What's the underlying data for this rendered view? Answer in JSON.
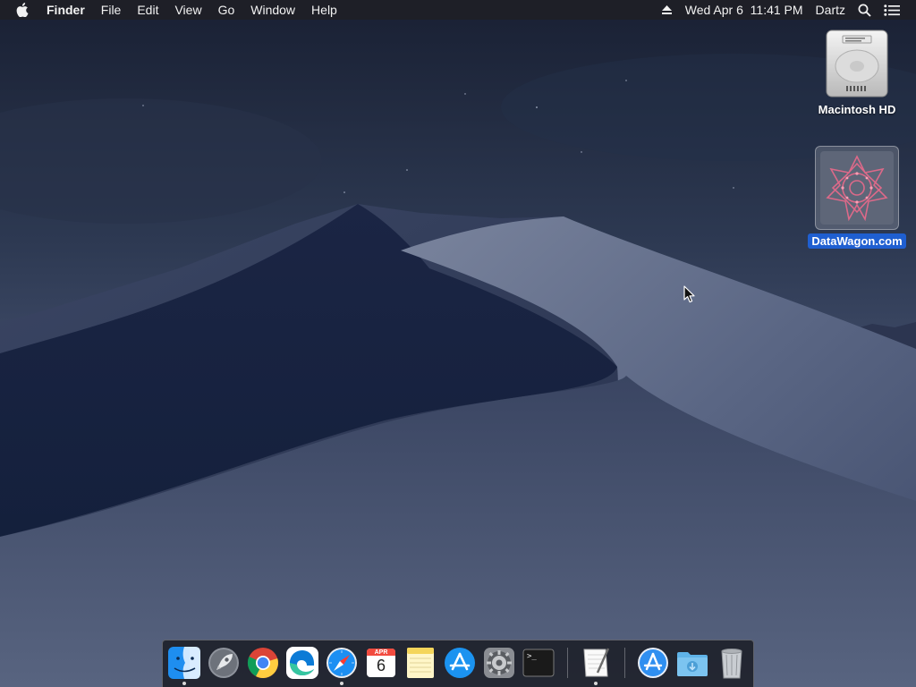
{
  "menubar": {
    "app_name": "Finder",
    "menus": [
      "File",
      "Edit",
      "View",
      "Go",
      "Window",
      "Help"
    ],
    "datetime": "Wed Apr 6  11:41 PM",
    "user": "Dartz"
  },
  "desktop": {
    "icons": [
      {
        "label": "Macintosh HD",
        "icon": "hard-drive-icon",
        "selected": false
      },
      {
        "label": "DataWagon.com",
        "icon": "disk-image-icon",
        "selected": true
      }
    ]
  },
  "dock": {
    "items": [
      {
        "name": "Finder",
        "icon": "finder-icon",
        "running": true
      },
      {
        "name": "Launchpad",
        "icon": "launchpad-icon",
        "running": false
      },
      {
        "name": "Google Chrome",
        "icon": "chrome-icon",
        "running": false
      },
      {
        "name": "Microsoft Edge",
        "icon": "edge-icon",
        "running": false
      },
      {
        "name": "Safari",
        "icon": "safari-icon",
        "running": true
      },
      {
        "name": "Calendar",
        "icon": "calendar-icon",
        "running": false,
        "month": "APR",
        "day": "6"
      },
      {
        "name": "Notes",
        "icon": "notes-icon",
        "running": false
      },
      {
        "name": "App Store",
        "icon": "app-store-icon",
        "running": false
      },
      {
        "name": "System Preferences",
        "icon": "gear-icon",
        "running": false
      },
      {
        "name": "Terminal",
        "icon": "terminal-icon",
        "running": false,
        "prompt": ">_"
      },
      {
        "name": "TextEdit",
        "icon": "textedit-icon",
        "running": true
      },
      {
        "name": "Applications",
        "icon": "applications-folder-icon",
        "running": false
      },
      {
        "name": "Downloads",
        "icon": "downloads-folder-icon",
        "running": false
      },
      {
        "name": "Trash",
        "icon": "trash-icon",
        "running": false
      }
    ]
  },
  "colors": {
    "menubar_bg": "#1e2026",
    "selection": "#1f5fd1",
    "sky_top": "#1a2235",
    "sky_bottom": "#3e4a66",
    "dune_light": "#5a6582",
    "dune_dark": "#1a2440"
  }
}
